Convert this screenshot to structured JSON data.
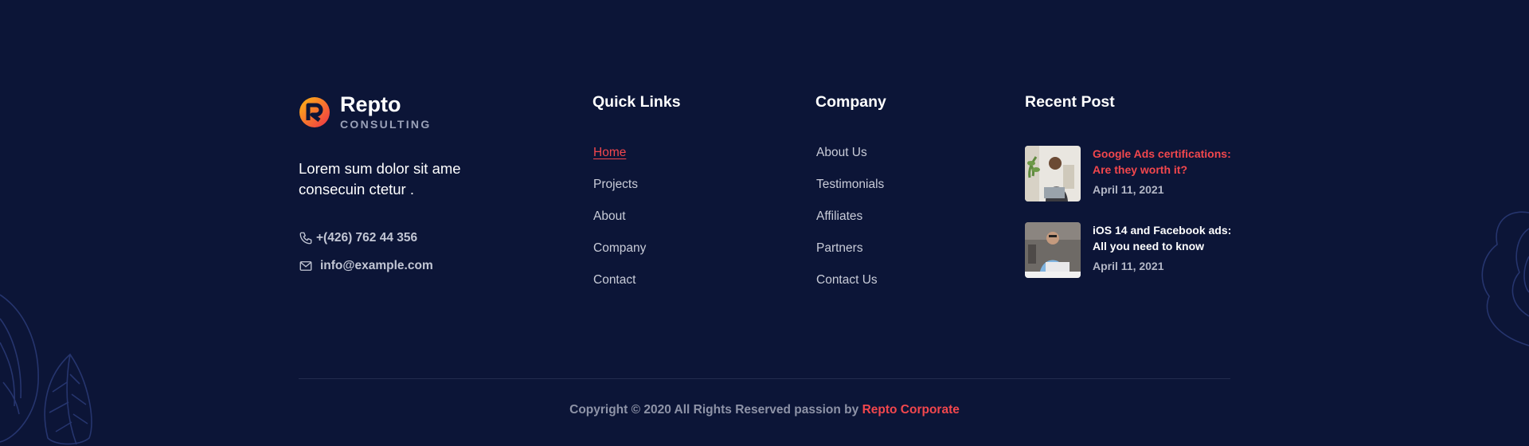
{
  "brand": {
    "name": "Repto",
    "tagline_word": "CONSULTING",
    "accent": "#f2474d"
  },
  "about": {
    "description": "Lorem sum dolor sit ame consecuin ctetur ."
  },
  "contact": {
    "phone": "+(426) 762 44 356",
    "email": "info@example.com",
    "phone_icon": "phone-icon",
    "email_icon": "mail-icon"
  },
  "quick_links": {
    "title": "Quick Links",
    "items": [
      {
        "label": "Home",
        "active": true
      },
      {
        "label": "Projects"
      },
      {
        "label": "About"
      },
      {
        "label": "Company"
      },
      {
        "label": "Contact"
      }
    ]
  },
  "company": {
    "title": "Company",
    "items": [
      {
        "label": "About Us"
      },
      {
        "label": "Testimonials"
      },
      {
        "label": "Affiliates"
      },
      {
        "label": "Partners"
      },
      {
        "label": "Contact Us"
      }
    ]
  },
  "recent_post": {
    "title": "Recent Post",
    "posts": [
      {
        "title": "Google Ads certifications: Are they worth it?",
        "date": "April 11, 2021",
        "highlighted": true
      },
      {
        "title": "iOS 14 and Facebook ads: All you need to know",
        "date": "April 11, 2021"
      }
    ]
  },
  "footer": {
    "copyright_prefix": "Copyright © 2020 All Rights Reserved passion by",
    "copyright_brand": "Repto Corporate"
  },
  "colors": {
    "background": "#0c1537",
    "accent": "#f2474d",
    "leaf_outline": "#26356e"
  }
}
